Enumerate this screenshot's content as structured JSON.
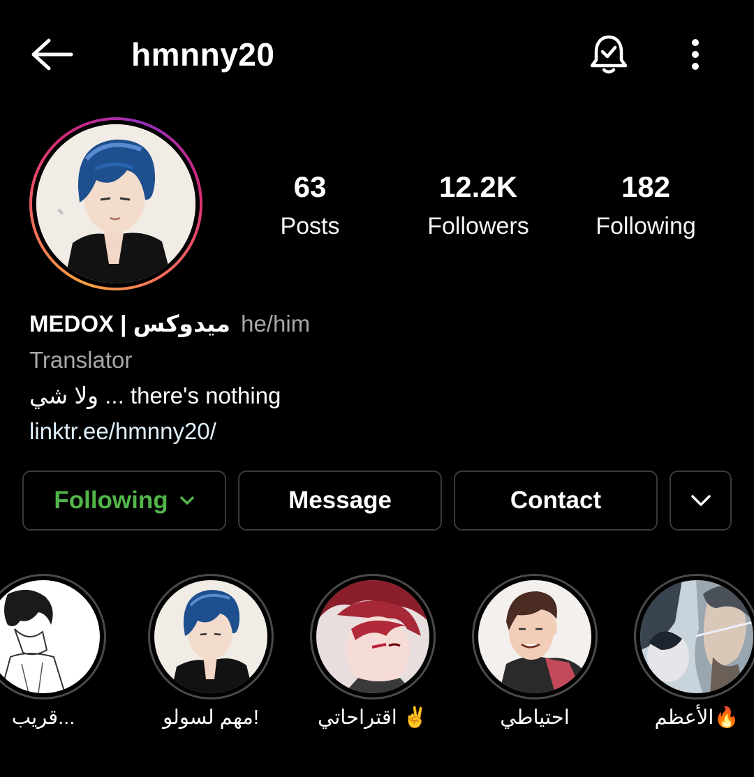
{
  "header": {
    "username": "hmnny20",
    "back_icon": "arrow-left-icon",
    "bell_icon": "bell-check-icon",
    "more_icon": "more-vertical-icon"
  },
  "profile": {
    "stats": [
      {
        "value": "63",
        "label": "Posts"
      },
      {
        "value": "12.2K",
        "label": "Followers"
      },
      {
        "value": "182",
        "label": "Following"
      }
    ],
    "name": "MEDOX | ميدوكس",
    "pronouns": "he/him",
    "category": "Translator",
    "bio": "ولا شي ... there's nothing",
    "link": "linktr.ee/hmnny20/"
  },
  "actions": {
    "following_label": "Following",
    "message_label": "Message",
    "contact_label": "Contact"
  },
  "highlights": [
    {
      "label": "قريب..."
    },
    {
      "label": "مهم لسولو!"
    },
    {
      "label": "اقتراحاتي ✌️"
    },
    {
      "label": "احتياطي"
    },
    {
      "label": "الأعظم🔥"
    }
  ],
  "colors": {
    "background": "#000000",
    "following_green": "#52b44a",
    "secondary_text": "#a8a8a8",
    "link": "#e0f1ff",
    "button_border": "#3a3a3a"
  }
}
